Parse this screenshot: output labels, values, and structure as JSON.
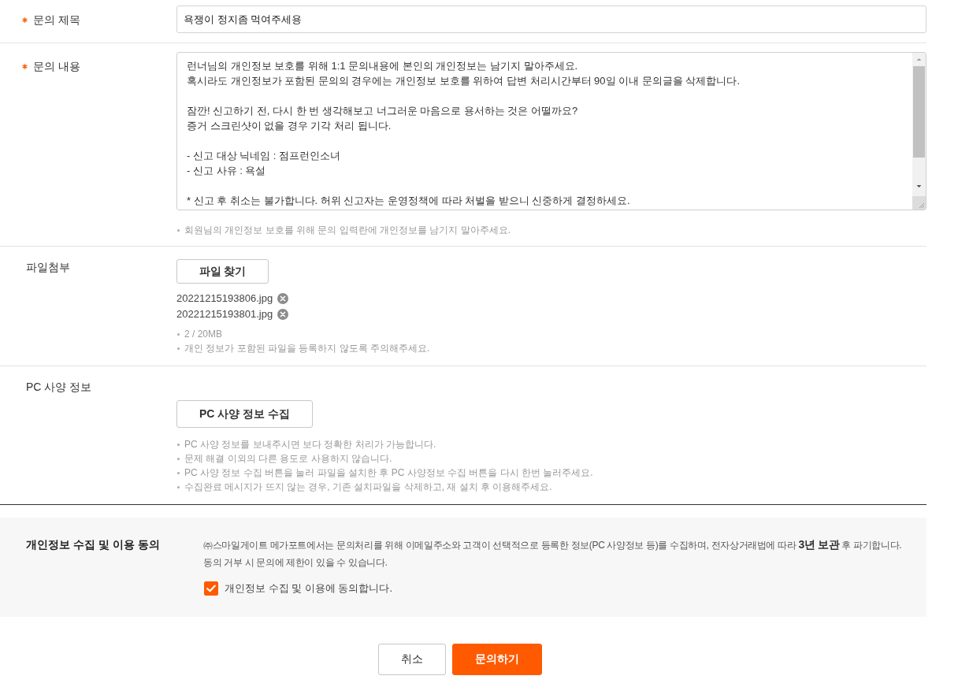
{
  "title_field": {
    "label": "문의 제목",
    "required": true,
    "value": "욕쟁이 정지좀 먹여주세용"
  },
  "content_field": {
    "label": "문의 내용",
    "required": true,
    "paragraphs": [
      [
        "런너님의 개인정보 보호를 위해 1:1 문의내용에 본인의 개인정보는 남기지 말아주세요.",
        "혹시라도 개인정보가 포함된 문의의 경우에는 개인정보 보호를 위하여 답변 처리시간부터 90일 이내 문의글을 삭제합니다."
      ],
      [
        "잠깐! 신고하기 전, 다시 한 번 생각해보고 너그러운 마음으로 용서하는 것은 어떨까요?",
        "증거 스크린샷이 없을 경우 기각 처리 됩니다."
      ],
      [
        "- 신고 대상 닉네임 : 점프런인소녀",
        "- 신고 사유 : 욕설"
      ],
      [
        "* 신고 후 취소는 불가합니다. 허위 신고자는 운영정책에 따라 처벌을 받으니 신중하게 결정하세요."
      ]
    ],
    "notes": [
      "회원님의 개인정보 보호를 위해 문의 입력란에 개인정보를 남기지 말아주세요."
    ]
  },
  "attachment": {
    "label": "파일첨부",
    "required": false,
    "button": "파일 찾기",
    "files": [
      {
        "name": "20221215193806.jpg"
      },
      {
        "name": "20221215193801.jpg"
      }
    ],
    "notes": [
      "2 / 20MB",
      "개인 정보가 포함된 파일을 등록하지 않도록 주의해주세요."
    ]
  },
  "pc_info": {
    "label": "PC 사양 정보",
    "required": false,
    "button": "PC 사양 정보 수집",
    "notes": [
      "PC 사양 정보를 보내주시면 보다 정확한 처리가 가능합니다.",
      "문제 해결 이외의 다른 용도로 사용하지 않습니다.",
      "PC 사양 정보 수집 버튼을 눌러 파일을 설치한 후 PC 사양정보 수집 버튼을 다시 한번 눌러주세요.",
      "수집완료 메시지가 뜨지 않는 경우, 기존 설치파일을 삭제하고, 재 설치 후 이용해주세요."
    ]
  },
  "consent": {
    "title": "개인정보 수집 및 이용 동의",
    "lines": [
      "㈜스마일게이트 메가포트에서는 문의처리를 위해 이메일주소와 고객이 선택적으로 등록한 정보(PC 사양정보 등)를 수집하며, 전자상거래법에 따라 **3년 보관** 후 파기합니다.",
      "동의 거부 시 문의에 제한이 있을 수 있습니다."
    ],
    "checkbox": {
      "label": "개인정보 수집 및 이용에 동의합니다.",
      "checked": true
    }
  },
  "buttons": [
    {
      "label": "취소",
      "kind": "secondary"
    },
    {
      "label": "문의하기",
      "kind": "primary"
    }
  ]
}
